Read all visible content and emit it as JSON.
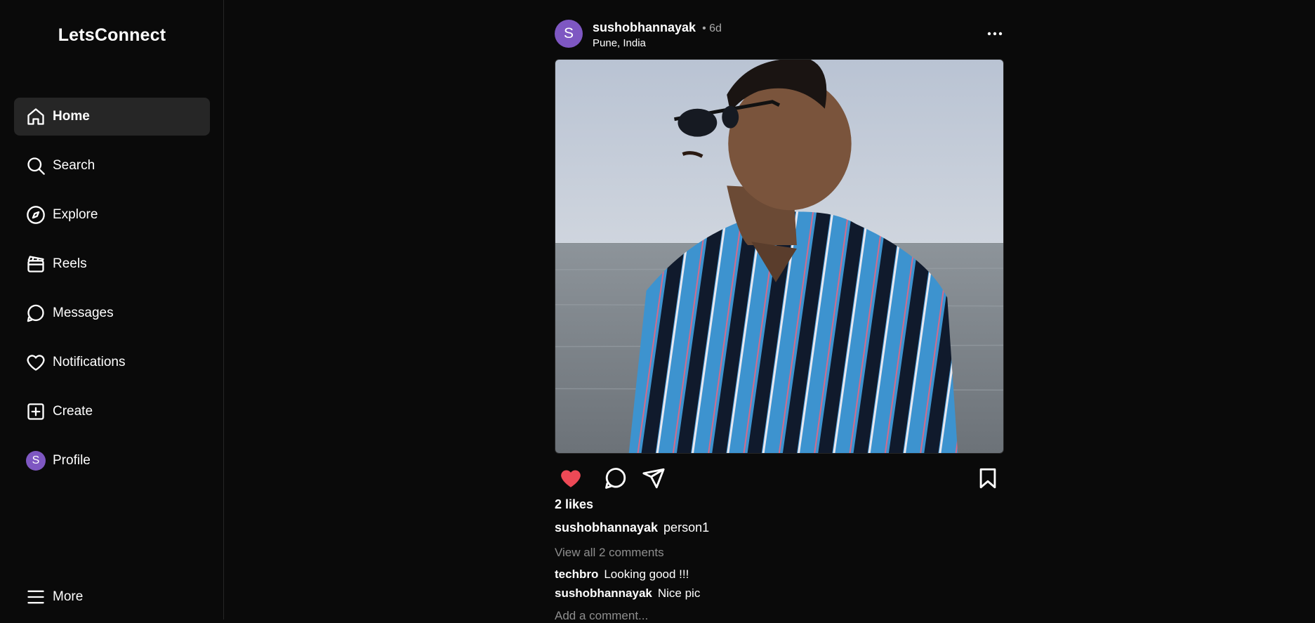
{
  "app": {
    "brand": "LetsConnect"
  },
  "sidebar": {
    "items": [
      {
        "label": "Home",
        "icon": "home-icon",
        "active": true
      },
      {
        "label": "Search",
        "icon": "search-icon"
      },
      {
        "label": "Explore",
        "icon": "compass-icon"
      },
      {
        "label": "Reels",
        "icon": "reels-icon"
      },
      {
        "label": "Messages",
        "icon": "message-icon"
      },
      {
        "label": "Notifications",
        "icon": "heart-icon"
      },
      {
        "label": "Create",
        "icon": "plus-square-icon"
      },
      {
        "label": "Profile",
        "icon": "avatar",
        "avatar_letter": "S"
      }
    ],
    "more_label": "More"
  },
  "post": {
    "avatar_letter": "S",
    "avatar_color": "#7e57c2",
    "username": "sushobhannayak",
    "time": "• 6d",
    "location": "Pune, India",
    "liked": true,
    "like_color": "#ed4956",
    "likes_text": "2 likes",
    "caption": {
      "user": "sushobhannayak",
      "text": "person1"
    },
    "view_all_comments": "View all 2 comments",
    "comments": [
      {
        "user": "techbro",
        "text": "Looking good !!!"
      },
      {
        "user": "sushobhannayak",
        "text": "Nice pic"
      }
    ],
    "add_comment_placeholder": "Add a comment..."
  }
}
